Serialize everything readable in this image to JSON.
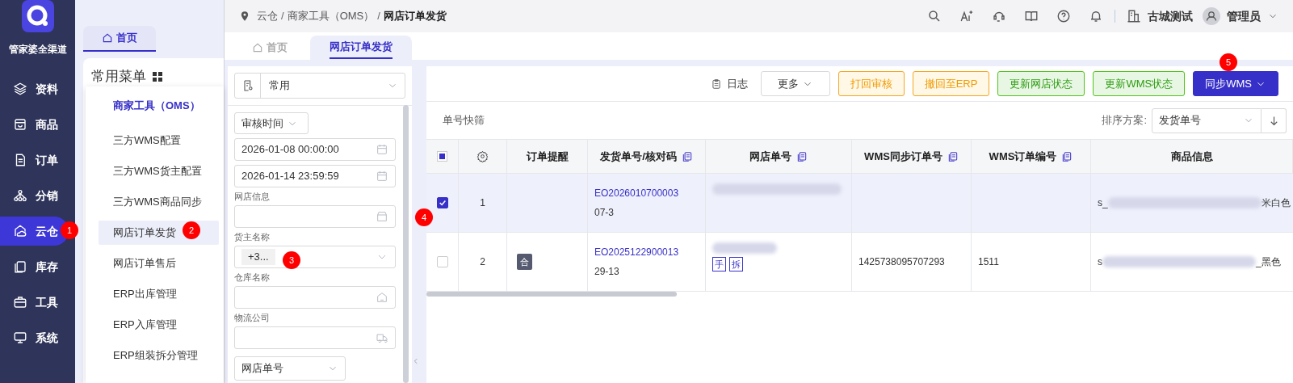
{
  "app": {
    "logo_text": "管家婆全渠道"
  },
  "nav": [
    {
      "label": "资料",
      "selected": false
    },
    {
      "label": "商品",
      "selected": false
    },
    {
      "label": "订单",
      "selected": false
    },
    {
      "label": "分销",
      "selected": false
    },
    {
      "label": "云仓",
      "selected": true
    },
    {
      "label": "库存",
      "selected": false
    },
    {
      "label": "工具",
      "selected": false
    },
    {
      "label": "系统",
      "selected": false
    }
  ],
  "home_tab": "首页",
  "menu_title": "常用菜单",
  "submenu": {
    "heading": "商家工具（OMS）",
    "items": [
      {
        "label": "三方WMS配置",
        "selected": false
      },
      {
        "label": "三方WMS货主配置",
        "selected": false
      },
      {
        "label": "三方WMS商品同步",
        "selected": false
      },
      {
        "label": "网店订单发货",
        "selected": true
      },
      {
        "label": "网店订单售后",
        "selected": false
      },
      {
        "label": "ERP出库管理",
        "selected": false
      },
      {
        "label": "ERP入库管理",
        "selected": false
      },
      {
        "label": "ERP组装拆分管理",
        "selected": false
      }
    ]
  },
  "breadcrumb": {
    "separator": "/",
    "items": [
      "云仓",
      "商家工具（OMS）",
      "网店订单发货"
    ]
  },
  "header": {
    "company": "古城测试",
    "user": "管理员"
  },
  "page_tabs": [
    {
      "label": "首页",
      "selected": false
    },
    {
      "label": "网店订单发货",
      "selected": true
    }
  ],
  "filters": {
    "scheme": "常用",
    "time_type": "审核时间",
    "start": "2026-01-08 00:00:00",
    "end": "2026-01-14 23:59:59",
    "fields": [
      {
        "label": "网店信息"
      },
      {
        "label": "货主名称",
        "tag": "+3..."
      },
      {
        "label": "仓库名称"
      },
      {
        "label": "物流公司"
      }
    ],
    "order_type": "网店单号"
  },
  "toolbar": {
    "log": "日志",
    "more": "更多",
    "buttons": [
      {
        "label": "打回审核",
        "kind": "warning"
      },
      {
        "label": "撤回至ERP",
        "kind": "warning"
      },
      {
        "label": "更新网店状态",
        "kind": "success"
      },
      {
        "label": "更新WMS状态",
        "kind": "success"
      },
      {
        "label": "同步WMS",
        "kind": "primary"
      }
    ]
  },
  "quick_filter": "单号快筛",
  "sort": {
    "label": "排序方案:",
    "value": "发货单号"
  },
  "table": {
    "select_all": {
      "checked": false,
      "indeterminate": true
    },
    "columns": [
      {
        "label": "订单提醒",
        "copy": false
      },
      {
        "label": "发货单号/核对码",
        "copy": true
      },
      {
        "label": "网店单号",
        "copy": true
      },
      {
        "label": "WMS同步订单号",
        "copy": true
      },
      {
        "label": "WMS订单编号",
        "copy": true
      },
      {
        "label": "商品信息",
        "copy": false
      }
    ],
    "rows": [
      {
        "selected": true,
        "index": "1",
        "order_no": "EO2026010700003",
        "check_code": "07-3",
        "product_start": "s_",
        "product_end": "米白色"
      },
      {
        "selected": false,
        "index": "2",
        "tag": "合",
        "order_no": "EO2025122900013",
        "check_code": "29-13",
        "shop_marks": [
          "手",
          "拆"
        ],
        "wms_sync": "1425738095707293",
        "wms_no": "1511",
        "product_start": "s",
        "product_end": "_黑色"
      }
    ]
  },
  "annotations": [
    "1",
    "2",
    "3",
    "4",
    "5"
  ]
}
